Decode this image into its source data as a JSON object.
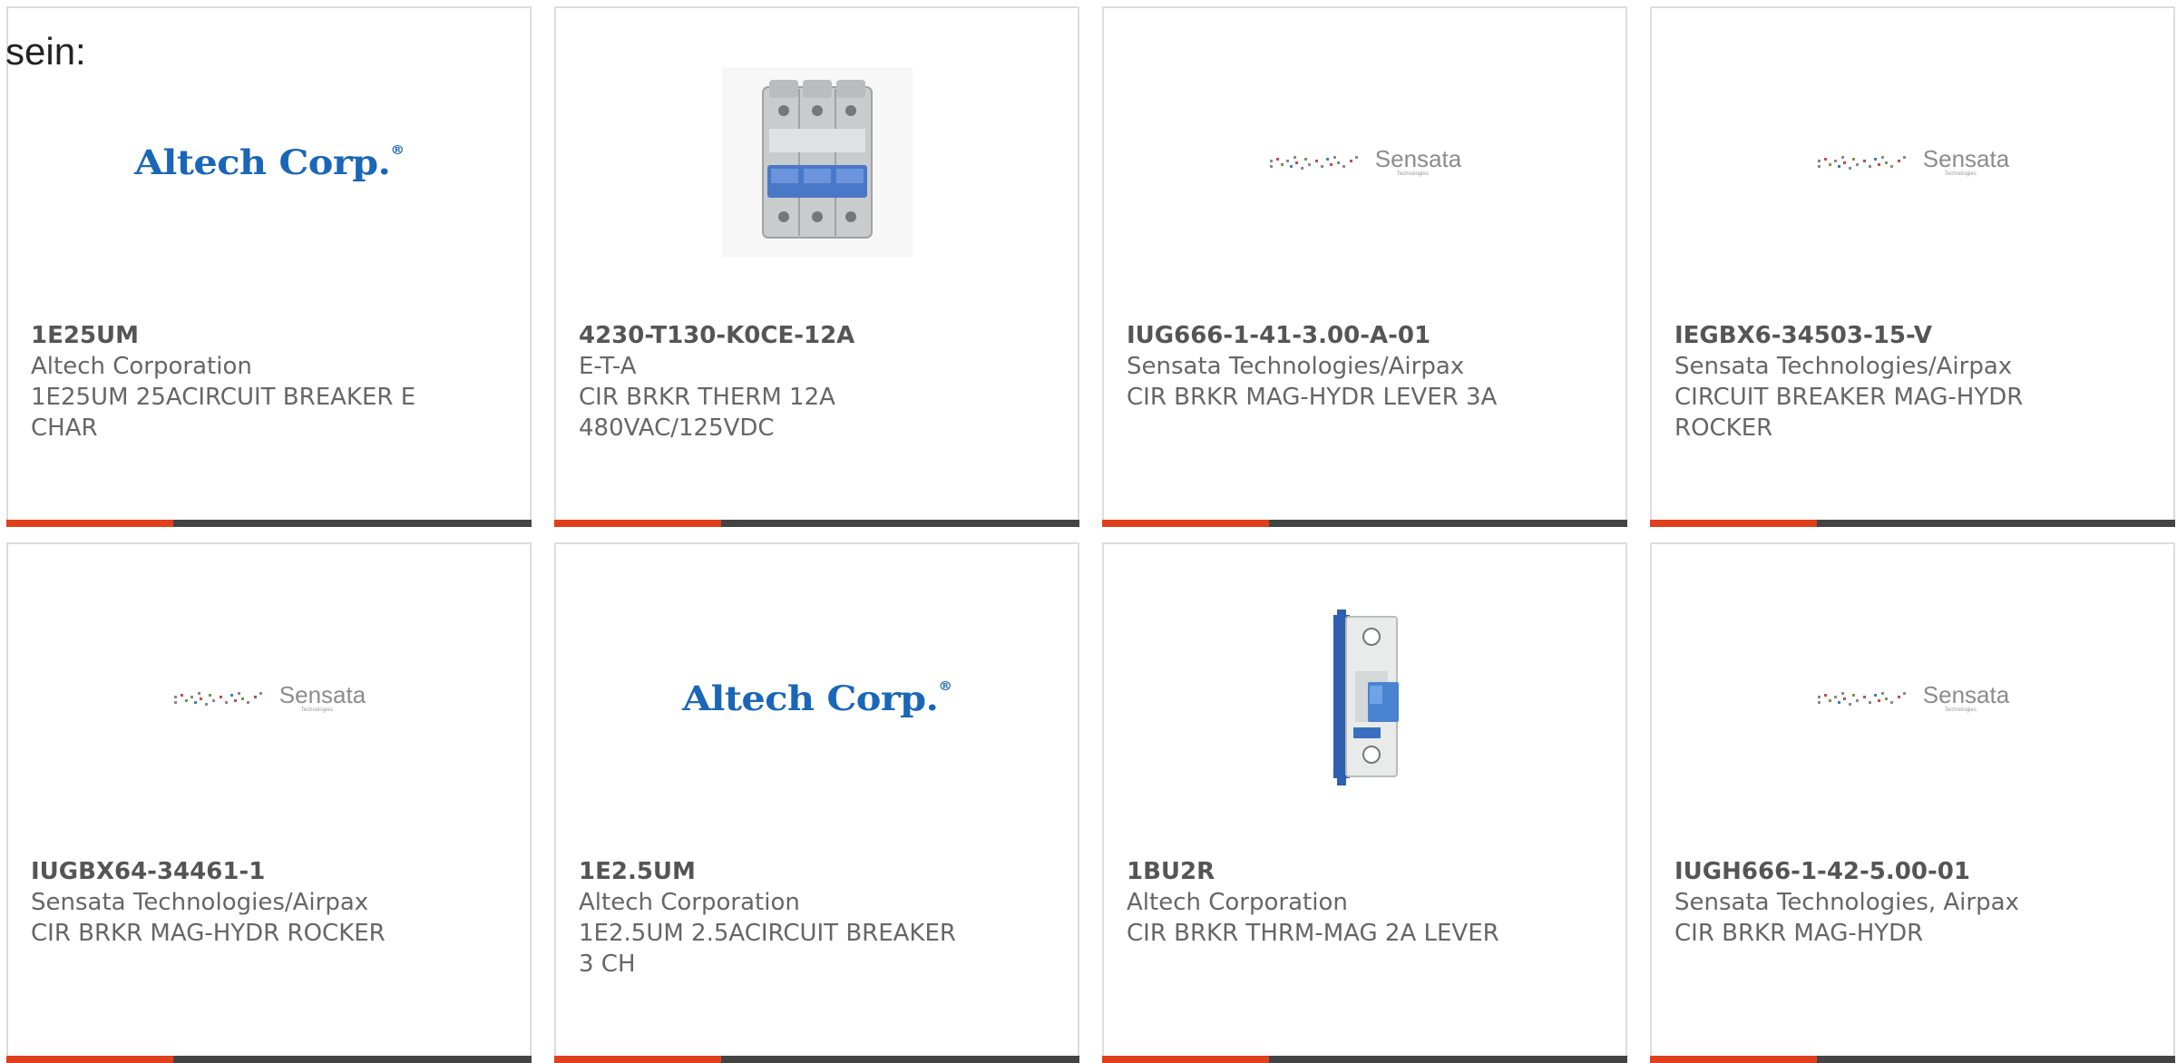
{
  "intro_text": "sein:",
  "colors": {
    "accent": "#e0401c",
    "bar": "#444444",
    "border": "#dddddd",
    "text": "#666666"
  },
  "products": [
    {
      "image": "altech-logo",
      "logo_text": "Altech Corp.",
      "part_number": "1E25UM",
      "manufacturer": "Altech Corporation",
      "description": "1E25UM 25ACIRCUIT BREAKER E CHAR"
    },
    {
      "image": "three-pole-breaker-photo",
      "part_number": "4230-T130-K0CE-12A",
      "manufacturer": "E-T-A",
      "description": "CIR BRKR THERM 12A 480VAC/125VDC"
    },
    {
      "image": "sensata-logo",
      "logo_text": "Sensata",
      "logo_sub": "Technologies",
      "part_number": "IUG666-1-41-3.00-A-01",
      "manufacturer": "Sensata Technologies/Airpax",
      "description": "CIR BRKR MAG-HYDR LEVER 3A"
    },
    {
      "image": "sensata-logo",
      "logo_text": "Sensata",
      "logo_sub": "Technologies",
      "part_number": "IEGBX6-34503-15-V",
      "manufacturer": "Sensata Technologies/Airpax",
      "description": "CIRCUIT BREAKER MAG-HYDR ROCKER"
    },
    {
      "image": "sensata-logo",
      "logo_text": "Sensata",
      "logo_sub": "Technologies",
      "part_number": "IUGBX64-34461-1",
      "manufacturer": "Sensata Technologies/Airpax",
      "description": "CIR BRKR MAG-HYDR ROCKER"
    },
    {
      "image": "altech-logo",
      "logo_text": "Altech Corp.",
      "part_number": "1E2.5UM",
      "manufacturer": "Altech Corporation",
      "description": "1E2.5UM 2.5ACIRCUIT BREAKER 3 CH"
    },
    {
      "image": "single-pole-breaker-photo",
      "part_number": "1BU2R",
      "manufacturer": "Altech Corporation",
      "description": "CIR BRKR THRM-MAG 2A LEVER"
    },
    {
      "image": "sensata-logo",
      "logo_text": "Sensata",
      "logo_sub": "Technologies",
      "part_number": "IUGH666-1-42-5.00-01",
      "manufacturer": "Sensata Technologies, Airpax",
      "description": "CIR BRKR MAG-HYDR"
    }
  ]
}
